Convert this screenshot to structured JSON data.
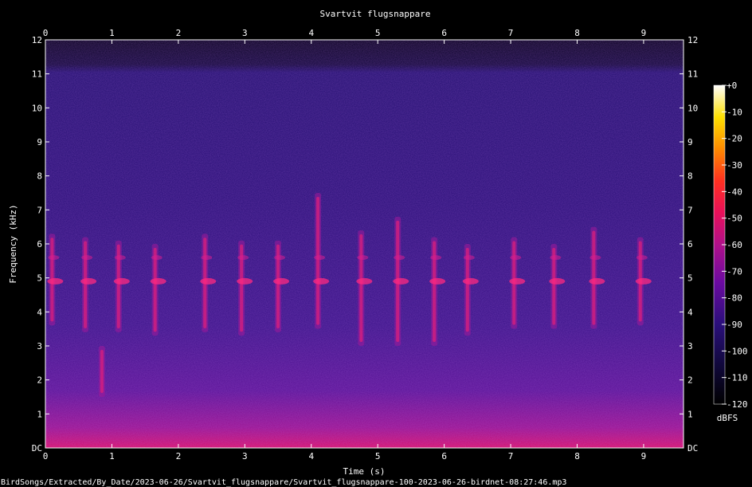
{
  "chart_data": {
    "type": "heatmap",
    "title": "Svartvit flugsnappare",
    "xlabel": "Time (s)",
    "ylabel": "Frequency (kHz)",
    "xlim": [
      0,
      9.6
    ],
    "ylim": [
      0,
      12
    ],
    "x_ticks": [
      "0",
      "1",
      "2",
      "3",
      "4",
      "5",
      "6",
      "7",
      "8",
      "9"
    ],
    "y_ticks": [
      "DC",
      "1",
      "2",
      "3",
      "4",
      "5",
      "6",
      "7",
      "8",
      "9",
      "10",
      "11",
      "12"
    ],
    "colorbar": {
      "unit": "dBFS",
      "range": [
        -120,
        0
      ],
      "ticks": [
        "+0",
        "-10",
        "-20",
        "-30",
        "-40",
        "-50",
        "-60",
        "-70",
        "-80",
        "-90",
        "-100",
        "-110",
        "-120"
      ]
    },
    "calls": [
      {
        "t": 0.1,
        "f_low": 3.6,
        "f_high": 6.3
      },
      {
        "t": 0.6,
        "f_low": 3.4,
        "f_high": 6.2
      },
      {
        "t": 0.85,
        "f_low": 1.5,
        "f_high": 3.0
      },
      {
        "t": 1.1,
        "f_low": 3.4,
        "f_high": 6.1
      },
      {
        "t": 1.65,
        "f_low": 3.3,
        "f_high": 6.0
      },
      {
        "t": 2.4,
        "f_low": 3.4,
        "f_high": 6.3
      },
      {
        "t": 2.95,
        "f_low": 3.3,
        "f_high": 6.1
      },
      {
        "t": 3.5,
        "f_low": 3.4,
        "f_high": 6.1
      },
      {
        "t": 4.1,
        "f_low": 3.5,
        "f_high": 7.5
      },
      {
        "t": 4.75,
        "f_low": 3.0,
        "f_high": 6.4
      },
      {
        "t": 5.3,
        "f_low": 3.0,
        "f_high": 6.8
      },
      {
        "t": 5.85,
        "f_low": 3.0,
        "f_high": 6.2
      },
      {
        "t": 6.35,
        "f_low": 3.3,
        "f_high": 6.0
      },
      {
        "t": 7.05,
        "f_low": 3.5,
        "f_high": 6.2
      },
      {
        "t": 7.65,
        "f_low": 3.5,
        "f_high": 6.0
      },
      {
        "t": 8.25,
        "f_low": 3.5,
        "f_high": 6.5
      },
      {
        "t": 8.95,
        "f_low": 3.6,
        "f_high": 6.2
      }
    ]
  },
  "footer": "BirdSongs/Extracted/By_Date/2023-06-26/Svartvit_flugsnappare/Svartvit_flugsnappare-100-2023-06-26-birdnet-08:27:46.mp3"
}
